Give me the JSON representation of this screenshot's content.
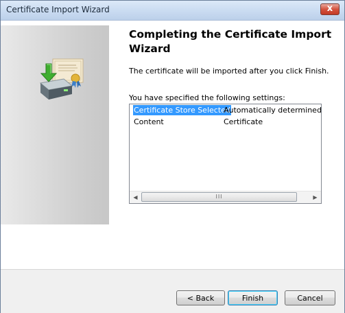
{
  "window": {
    "title": "Certificate Import Wizard",
    "close_glyph": "x"
  },
  "icons": {
    "wizard_art": "certificate-import-icon",
    "close": "close-icon",
    "scroll_left": "chevron-left-icon",
    "scroll_right": "chevron-right-icon"
  },
  "main": {
    "heading": "Completing the Certificate Import Wizard",
    "description": "The certificate will be imported after you click Finish.",
    "settings_label": "You have specified the following settings:"
  },
  "settings": [
    {
      "name": "Certificate Store Selected",
      "value": "Automatically determined by t",
      "selected": true
    },
    {
      "name": "Content",
      "value": "Certificate",
      "selected": false
    }
  ],
  "scrollbar": {
    "left_glyph": "◀",
    "right_glyph": "▶",
    "thumb_grip": "III"
  },
  "buttons": {
    "back": "< Back",
    "finish": "Finish",
    "cancel": "Cancel"
  },
  "colors": {
    "selection": "#3399ff",
    "default_button_border": "#3c7fb1"
  }
}
